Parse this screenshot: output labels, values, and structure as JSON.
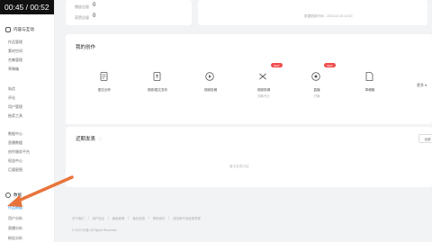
{
  "video": {
    "timestamp": "00:45 / 00:52"
  },
  "sidebar": {
    "groups": [
      {
        "label": "内容与互动",
        "items": [
          "作品管理",
          "素材空间",
          "合集管理",
          "草稿箱"
        ]
      },
      {
        "label": "",
        "items": [
          "私信",
          "评论",
          "用户管理",
          "抽奖工具"
        ]
      },
      {
        "label": "",
        "items": [
          "数据中心",
          "直播数据",
          "创作服务平台",
          "权益中心",
          "巨量星图"
        ]
      },
      {
        "label": "数据",
        "items": [
          "作品数据",
          "用户分析",
          "直播分析",
          "粉丝分析"
        ]
      }
    ],
    "active_item": "作品数据"
  },
  "stats": {
    "rows": [
      {
        "label": "播放总量",
        "value": "0"
      },
      {
        "label": "获赞总量",
        "value": "0"
      }
    ],
    "updated": "数据更新时间：2023-02-25 10:00"
  },
  "create": {
    "title": "我的创作",
    "tiles": [
      {
        "label": "图文创作",
        "sub": "",
        "icon": "image-doc-icon",
        "badge": ""
      },
      {
        "label": "视频/图文发布",
        "sub": "",
        "icon": "upload-doc-icon",
        "badge": ""
      },
      {
        "label": "视频投稿",
        "sub": "",
        "icon": "play-circle-icon",
        "badge": ""
      },
      {
        "label": "视频剪辑",
        "sub": "剪映专业",
        "icon": "capcut-icon",
        "badge": "NEW"
      },
      {
        "label": "直播",
        "sub": "开播",
        "icon": "live-icon",
        "badge": "NEW"
      },
      {
        "label": "草稿箱",
        "sub": "",
        "icon": "draft-icon",
        "badge": ""
      }
    ],
    "more": "更多 ▾"
  },
  "recent": {
    "title": "近期发表",
    "tab": "全部",
    "empty": "暂无发表内容"
  },
  "footer": {
    "links": [
      "关于我们",
      "|",
      "用户协议",
      "|",
      "隐私政策",
      "|",
      "营业执照",
      "|",
      "联系我们",
      "|",
      "违法和不良信息举报"
    ],
    "copyright": "© 2023 抖音 All Rights Reserved"
  },
  "colors": {
    "accent": "#1e8ae8",
    "arrow": "#e8743b",
    "badge": "#f04b4b"
  }
}
